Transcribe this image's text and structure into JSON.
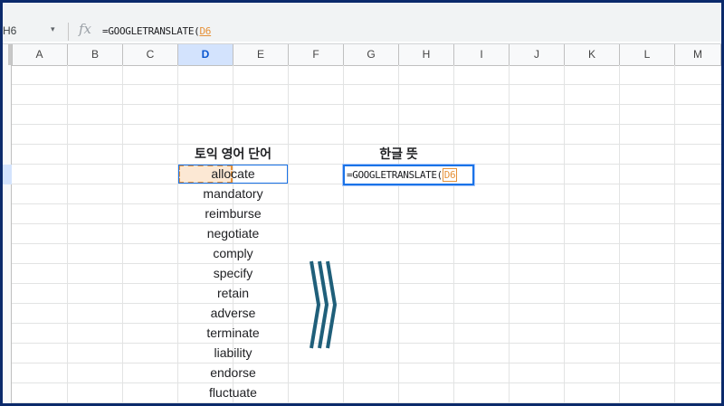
{
  "namebox": {
    "label": "H6",
    "arrow": "▾"
  },
  "formula_bar": {
    "fx": "fx",
    "formula_prefix": "=GOOGLETRANSLATE(",
    "formula_ref": "D6"
  },
  "columns": [
    "A",
    "B",
    "C",
    "D",
    "E",
    "F",
    "G",
    "H",
    "I",
    "J",
    "K",
    "L",
    "M"
  ],
  "selected_column": "D",
  "sheet": {
    "header_d": "토익 영어 단어",
    "header_g": "한글 뜻",
    "words": [
      "allocate",
      "mandatory",
      "reimburse",
      "negotiate",
      "comply",
      "specify",
      "retain",
      "adverse",
      "terminate",
      "liability",
      "endorse",
      "fluctuate"
    ],
    "edit_prefix": "=GOOGLETRANSLATE(",
    "edit_ref": "D6"
  },
  "colors": {
    "selection": "#1a73e8",
    "reference": "#e69138",
    "chevron": "#1f5f7a",
    "frame": "#0b2a6b"
  },
  "icons": {
    "chevron": "triple-chevron-right-icon"
  }
}
